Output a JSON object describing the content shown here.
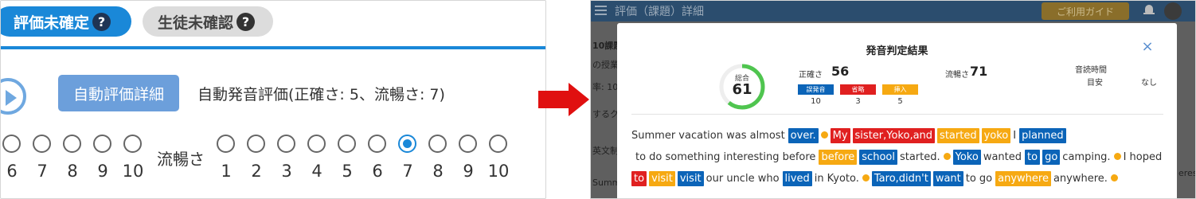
{
  "left": {
    "tags": [
      {
        "label": "評価未確定",
        "icon": "?"
      },
      {
        "label": "生徒未確認",
        "icon": "?"
      }
    ],
    "auto_button": "自動評価詳細",
    "auto_text": "自動発音評価(正確さ: 5、流暢さ: 7)",
    "fluency_label": "流暢さ",
    "accuracy_numbers": [
      "6",
      "7",
      "8",
      "9",
      "10"
    ],
    "fluency_numbers": [
      "1",
      "2",
      "3",
      "4",
      "5",
      "6",
      "7",
      "8",
      "9",
      "10"
    ],
    "fluency_selected": "7"
  },
  "right": {
    "app_title": "評価（課題）詳細",
    "guide_button": "ご利用ガイド",
    "bg_texts": [
      "10課題",
      "の授業",
      "率: 10",
      "するク",
      "英文制",
      "Summer",
      "eres"
    ],
    "modal": {
      "title": "発音判定結果",
      "close": "×",
      "total_label": "総合",
      "total_value": "61",
      "total_fraction": 0.61,
      "accuracy_label": "正確さ",
      "accuracy_value": "56",
      "badges": [
        {
          "label": "誤発音",
          "count": "10",
          "color": "#0b64b8"
        },
        {
          "label": "省略",
          "count": "3",
          "color": "#e02020"
        },
        {
          "label": "挿入",
          "count": "5",
          "color": "#f6a912"
        }
      ],
      "fluency_label": "流暢さ",
      "fluency_value": "71",
      "read_time_label": "音読時間",
      "read_time_sub": "目安",
      "read_time_value": "なし"
    },
    "lines": [
      [
        {
          "t": "Summer vacation was almost",
          "c": "plain"
        },
        {
          "t": "over.",
          "c": "mis"
        },
        {
          "t": "",
          "c": "dot"
        },
        {
          "t": "My",
          "c": "omit"
        },
        {
          "t": "sister,Yoko,and",
          "c": "omit"
        },
        {
          "t": "started",
          "c": "ins"
        },
        {
          "t": "yoko",
          "c": "ins"
        },
        {
          "t": "I",
          "c": "plain"
        },
        {
          "t": "planned",
          "c": "mis"
        }
      ],
      [
        {
          "t": "to do something interesting before",
          "c": "plain"
        },
        {
          "t": "before",
          "c": "ins"
        },
        {
          "t": "school",
          "c": "mis"
        },
        {
          "t": "started.",
          "c": "plain"
        },
        {
          "t": "",
          "c": "dot"
        },
        {
          "t": "Yoko",
          "c": "mis"
        },
        {
          "t": "wanted",
          "c": "plain"
        },
        {
          "t": "to",
          "c": "mis"
        },
        {
          "t": "go",
          "c": "mis"
        },
        {
          "t": "camping.",
          "c": "plain"
        },
        {
          "t": "",
          "c": "dot"
        },
        {
          "t": "I hoped",
          "c": "plain"
        }
      ],
      [
        {
          "t": "to",
          "c": "omit"
        },
        {
          "t": "visit",
          "c": "ins"
        },
        {
          "t": "visit",
          "c": "mis"
        },
        {
          "t": "our uncle who",
          "c": "plain"
        },
        {
          "t": "lived",
          "c": "mis"
        },
        {
          "t": "in Kyoto.",
          "c": "plain"
        },
        {
          "t": "",
          "c": "dot"
        },
        {
          "t": "Taro,didn't",
          "c": "mis"
        },
        {
          "t": "want",
          "c": "mis"
        },
        {
          "t": "to go",
          "c": "plain"
        },
        {
          "t": "anywhere",
          "c": "ins"
        },
        {
          "t": "anywhere.",
          "c": "plain"
        },
        {
          "t": "",
          "c": "dot"
        }
      ]
    ]
  }
}
